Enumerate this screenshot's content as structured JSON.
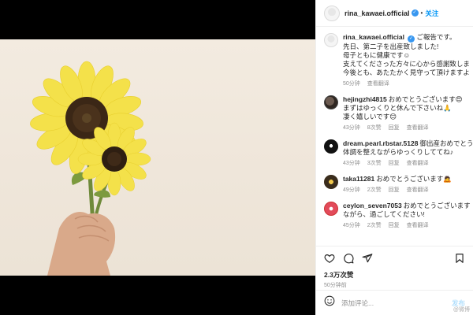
{
  "post": {
    "username": "rina_kawaei.official",
    "follow_label": "关注",
    "caption_lines": [
      "ご報告です。",
      "先日、第二子を出産致しました!",
      "母子ともに健康です☺",
      "支えてくださった方々に心から感謝致しま",
      "今後とも、あたたかく見守って頂けますよ"
    ],
    "caption_time": "50分钟",
    "translate_label": "查看翻译"
  },
  "comments": [
    {
      "user": "hejingzhi4815",
      "lines": [
        "おめでとうございます😍",
        "まずはゆっくりと休んで下さいね🙏",
        "凄く嬉しいです😊"
      ],
      "time": "43分钟",
      "likes": "8次赞",
      "reply": "回复",
      "translate": "查看翻译"
    },
    {
      "user": "dream.pearl.rbstar.5128",
      "lines": [
        "御出産おめでとう",
        "体調を整えながらゆっくりしててね♪"
      ],
      "time": "43分钟",
      "likes": "3次赞",
      "reply": "回复",
      "translate": "查看翻译"
    },
    {
      "user": "taka11281",
      "lines": [
        "おめでとうございます🙇"
      ],
      "time": "49分钟",
      "likes": "2次赞",
      "reply": "回复",
      "translate": "查看翻译"
    },
    {
      "user": "ceylon_seven7053",
      "lines": [
        "おめでとうございます",
        "ながら、過ごしてください!"
      ],
      "time": "45分钟",
      "likes": "2次赞",
      "reply": "回复",
      "translate": "查看翻译"
    }
  ],
  "footer": {
    "likes": "2.3万次赞",
    "time_ago": "50分钟前",
    "comment_placeholder": "添加评论...",
    "post_label": "发布",
    "watermark": "@微博"
  },
  "colors": {
    "accent": "#0095f6",
    "verified": "#3897f0",
    "meta_gray": "#8e8e8e"
  }
}
